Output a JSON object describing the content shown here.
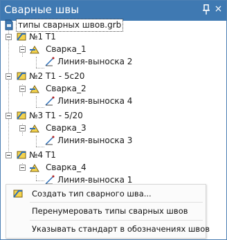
{
  "panel": {
    "title": "Сварные швы",
    "pin_icon": "pin-icon",
    "close_icon": "×"
  },
  "tree": {
    "root": "типы сварных швов.grb",
    "groups": [
      {
        "label": "№1 Т1",
        "weld": "Сварка_1",
        "leader": "Линия-выноска 2"
      },
      {
        "label": "№2 Т1 - 5c20",
        "weld": "Сварка_2",
        "leader": "Линия-выноска 4"
      },
      {
        "label": "№3 Т1 - 5/20",
        "weld": "Сварка_3",
        "leader": "Линия-выноска 3"
      },
      {
        "label": "№4 Т1",
        "weld": "Сварка_4",
        "leader": "Линия-выноска 1"
      }
    ]
  },
  "context_menu": {
    "create": "Создать тип сварного шва...",
    "renumber": "Перенумеровать типы сварных швов",
    "standard": "Указывать стандарт в обозначениях швов"
  }
}
